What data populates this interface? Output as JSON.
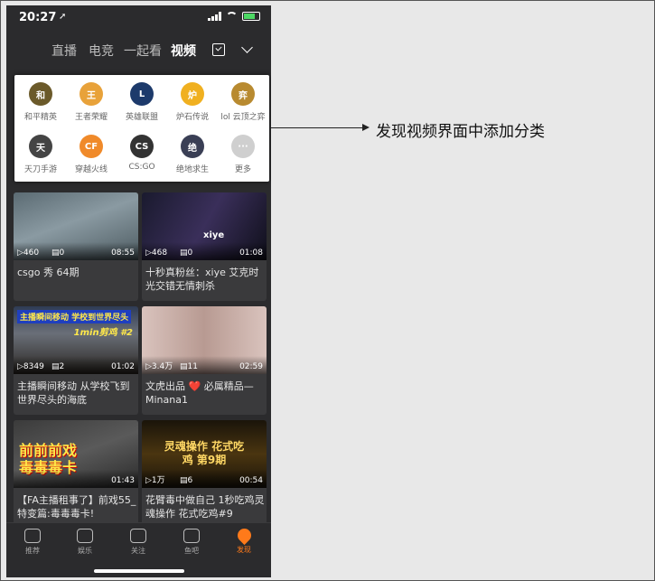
{
  "status": {
    "time": "20:27",
    "location_glyph": "➚"
  },
  "topnav": {
    "tabs": [
      "直播",
      "电竞",
      "一起看",
      "视频"
    ],
    "active_index": 3
  },
  "categories": [
    {
      "label": "和平精英",
      "glyph": "和",
      "color": "#6b5a2a"
    },
    {
      "label": "王者荣耀",
      "glyph": "王",
      "color": "#e8a23a"
    },
    {
      "label": "英雄联盟",
      "glyph": "L",
      "color": "#1d3a6b"
    },
    {
      "label": "炉石传说",
      "glyph": "炉",
      "color": "#f0b020"
    },
    {
      "label": "lol 云顶之弈",
      "glyph": "弈",
      "color": "#b88a30"
    },
    {
      "label": "天刀手游",
      "glyph": "天",
      "color": "#444444"
    },
    {
      "label": "穿越火线",
      "glyph": "CF",
      "color": "#f08a2a"
    },
    {
      "label": "CS:GO",
      "glyph": "CS",
      "color": "#333333"
    },
    {
      "label": "绝地求生",
      "glyph": "绝",
      "color": "#3a3f55"
    },
    {
      "label": "更多",
      "glyph": "···",
      "color": "#cfcfcf"
    }
  ],
  "videos": [
    {
      "views": "▷460",
      "comments": "▤0",
      "duration": "08:55",
      "title": "csgo 秀 64期",
      "thumb_text": ""
    },
    {
      "views": "▷468",
      "comments": "▤0",
      "duration": "01:08",
      "title": "十秒真粉丝：xiye 艾克时光交错无情刺杀",
      "thumb_text": "xiye"
    },
    {
      "views": "▷8349",
      "comments": "▤2",
      "duration": "01:02",
      "title": "主播瞬间移动 从学校飞到世界尽头的海底",
      "thumb_text": "主播瞬间移动 学校到世界尽头",
      "thumb_sub": "1min剪鸡 #2"
    },
    {
      "views": "▷3.4万",
      "comments": "▤11",
      "duration": "02:59",
      "title": "文虎出品 ❤️ 必属精品—Minana1",
      "thumb_text": ""
    },
    {
      "views": "",
      "comments": "",
      "duration": "01:43",
      "title": "【FA主播租事了】前戏55_特变篇:毒毒毒卡!",
      "thumb_text": "前前前戏 毒毒毒卡"
    },
    {
      "views": "▷1万",
      "comments": "▤6",
      "duration": "00:54",
      "title": "花臂毒中做自己 1秒吃鸡灵魂操作 花式吃鸡#9",
      "thumb_text": "灵魂操作 花式吃鸡 第9期"
    }
  ],
  "bottomnav": {
    "items": [
      "推荐",
      "娱乐",
      "关注",
      "鱼吧",
      "发现"
    ],
    "active_index": 4,
    "accent": "#ff7a1a"
  },
  "annotation": {
    "text": "发现视频界面中添加分类"
  }
}
